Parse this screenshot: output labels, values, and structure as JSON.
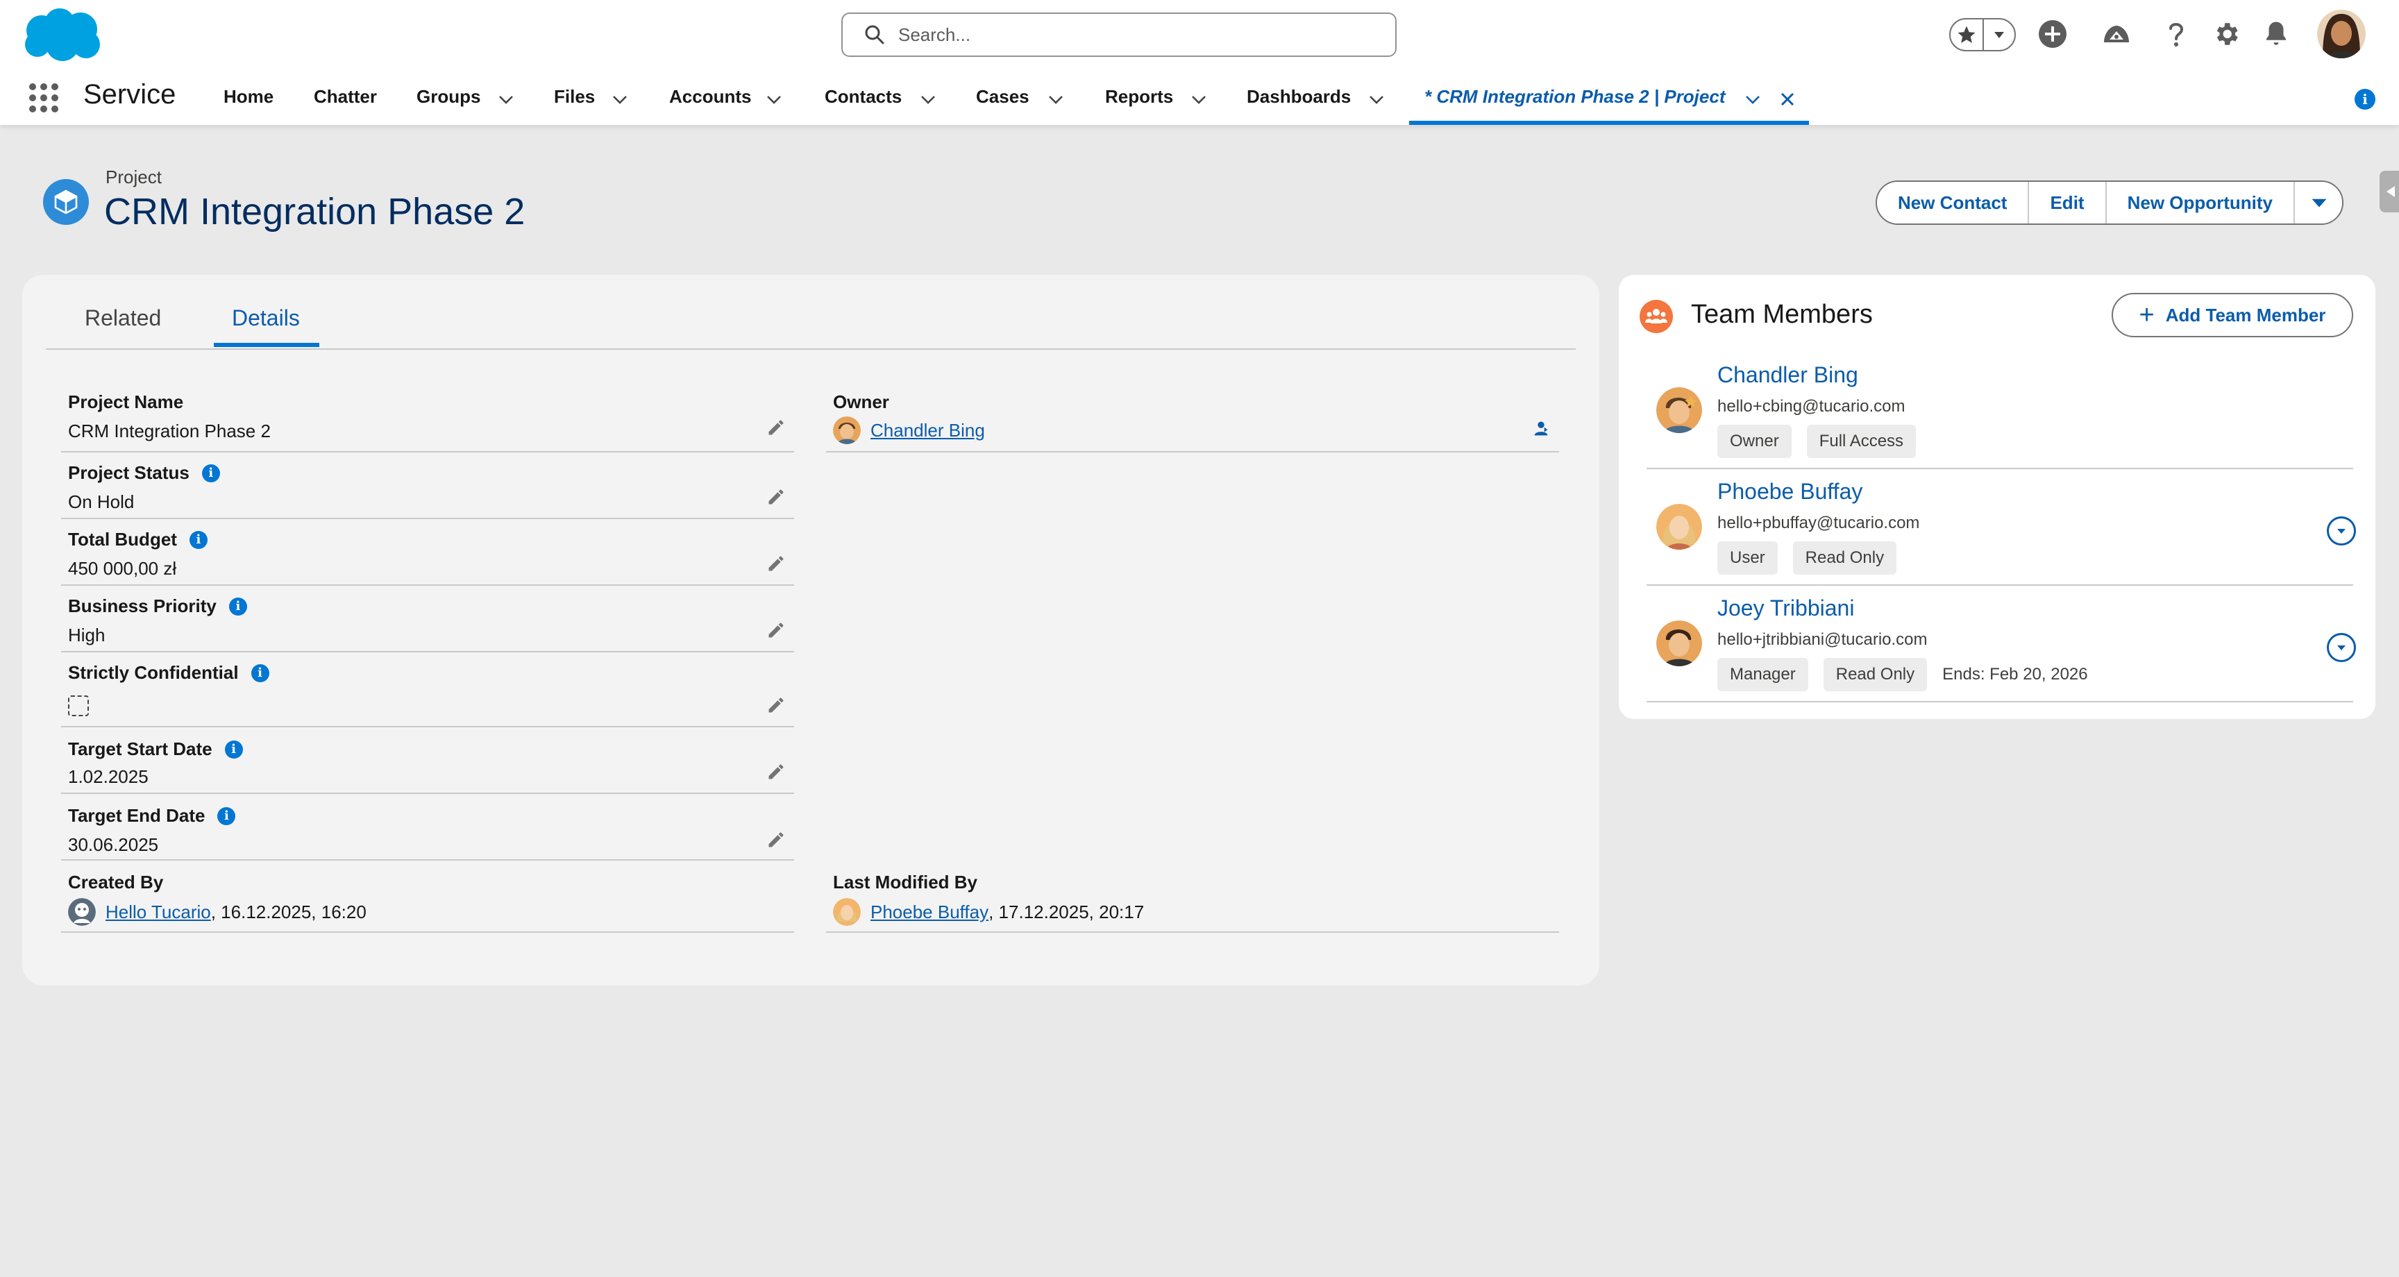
{
  "header": {
    "search_placeholder": "Search..."
  },
  "nav": {
    "app_name": "Service",
    "items": [
      {
        "label": "Home",
        "has_menu": false
      },
      {
        "label": "Chatter",
        "has_menu": false
      },
      {
        "label": "Groups",
        "has_menu": true
      },
      {
        "label": "Files",
        "has_menu": true
      },
      {
        "label": "Accounts",
        "has_menu": true
      },
      {
        "label": "Contacts",
        "has_menu": true
      },
      {
        "label": "Cases",
        "has_menu": true
      },
      {
        "label": "Reports",
        "has_menu": true
      },
      {
        "label": "Dashboards",
        "has_menu": true
      }
    ],
    "active_tab": "* CRM Integration Phase 2 | Project"
  },
  "record": {
    "object_type": "Project",
    "title": "CRM Integration Phase 2",
    "actions": [
      "New Contact",
      "Edit",
      "New Opportunity"
    ]
  },
  "tabs": {
    "related": "Related",
    "details": "Details",
    "active": "Details"
  },
  "details": {
    "project_name": {
      "label": "Project Name",
      "value": "CRM Integration Phase 2"
    },
    "project_status": {
      "label": "Project Status",
      "value": "On Hold"
    },
    "total_budget": {
      "label": "Total Budget",
      "value": "450 000,00 zł"
    },
    "business_priority": {
      "label": "Business Priority",
      "value": "High"
    },
    "strictly_confidential": {
      "label": "Strictly Confidential",
      "checked": false
    },
    "target_start_date": {
      "label": "Target Start Date",
      "value": "1.02.2025"
    },
    "target_end_date": {
      "label": "Target End Date",
      "value": "30.06.2025"
    },
    "created_by": {
      "label": "Created By",
      "user": "Hello Tucario",
      "timestamp": ", 16.12.2025, 16:20"
    },
    "owner": {
      "label": "Owner",
      "user": "Chandler Bing"
    },
    "last_modified_by": {
      "label": "Last Modified By",
      "user": "Phoebe Buffay",
      "timestamp": ", 17.12.2025, 20:17"
    }
  },
  "team": {
    "title": "Team Members",
    "add_label": "Add Team Member",
    "members": [
      {
        "name": "Chandler Bing",
        "email": "hello+cbing@tucario.com",
        "role": "Owner",
        "access": "Full Access",
        "ends": ""
      },
      {
        "name": "Phoebe Buffay",
        "email": "hello+pbuffay@tucario.com",
        "role": "User",
        "access": "Read Only",
        "ends": ""
      },
      {
        "name": "Joey Tribbiani",
        "email": "hello+jtribbiani@tucario.com",
        "role": "Manager",
        "access": "Read Only",
        "ends": "Ends: Feb 20, 2026"
      }
    ]
  },
  "colors": {
    "brand_blue": "#0176d3",
    "link_blue": "#0b5cab",
    "title_navy": "#032d60",
    "team_icon": "#f4753e",
    "page_bg": "#e9e9e9"
  },
  "icons": [
    "salesforce-cloud-icon",
    "search-icon",
    "star-icon",
    "plus-circle-icon",
    "trailhead-icon",
    "help-icon",
    "gear-icon",
    "bell-icon",
    "app-launcher-icon",
    "chevron-down-icon",
    "close-icon",
    "project-icon",
    "info-icon",
    "pencil-icon",
    "change-owner-icon",
    "team-icon"
  ]
}
